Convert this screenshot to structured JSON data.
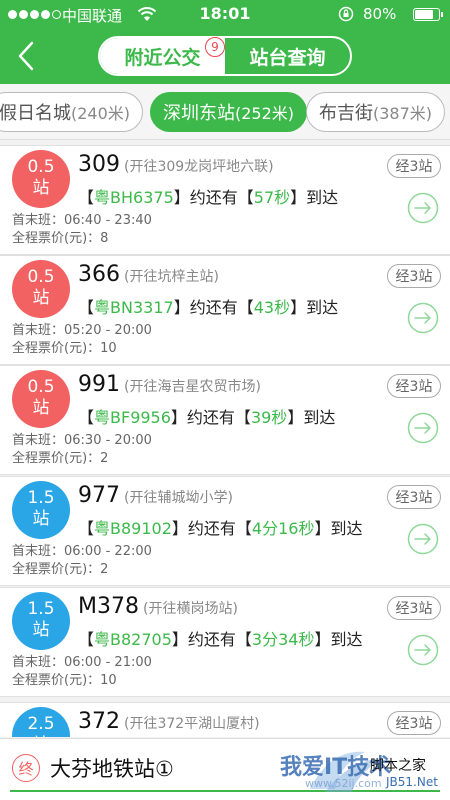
{
  "status_bar": {
    "carrier": "中国联通",
    "time": "18:01",
    "battery": "80%",
    "battery_level": 0.8
  },
  "header": {
    "tabs": [
      {
        "label": "附近公交",
        "badge": "9"
      },
      {
        "label": "站台查询"
      }
    ]
  },
  "stations": [
    {
      "name": "假日名城",
      "dist": "(240米)"
    },
    {
      "name": "深圳东站",
      "dist": "(252米)"
    },
    {
      "name": "布吉街",
      "dist": "(387米)"
    }
  ],
  "routes": [
    {
      "fare": "0.5",
      "fare_unit": "站",
      "color": "#f26262",
      "number": "309",
      "direction": "(开往309龙岗坪地六联)",
      "plate_open": "【",
      "plate": "粤BH6375",
      "mid": "】约还有【",
      "eta": "57秒",
      "tail": "】到达",
      "schedule": "首末班：06:40 - 23:40",
      "price": "全程票价(元)：8",
      "stops": "经3站"
    },
    {
      "fare": "0.5",
      "fare_unit": "站",
      "color": "#f26262",
      "number": "366",
      "direction": "(开往坑梓主站)",
      "plate_open": "【",
      "plate": "粤BN3317",
      "mid": "】约还有【",
      "eta": "43秒",
      "tail": "】到达",
      "schedule": "首末班：05:20 - 20:00",
      "price": "全程票价(元)：10",
      "stops": "经3站"
    },
    {
      "fare": "0.5",
      "fare_unit": "站",
      "color": "#f26262",
      "number": "991",
      "direction": "(开往海吉星农贸市场)",
      "plate_open": "【",
      "plate": "粤BF9956",
      "mid": "】约还有【",
      "eta": "39秒",
      "tail": "】到达",
      "schedule": "首末班：06:30 - 20:00",
      "price": "全程票价(元)：2",
      "stops": "经3站"
    },
    {
      "fare": "1.5",
      "fare_unit": "站",
      "color": "#2aa5e6",
      "number": "977",
      "direction": "(开往辅城坳小学)",
      "plate_open": "【",
      "plate": "粤B89102",
      "mid": "】约还有【",
      "eta": "4分16秒",
      "tail": "】到达",
      "schedule": "首末班：06:00 - 22:00",
      "price": "全程票价(元)：2",
      "stops": "经3站"
    },
    {
      "fare": "1.5",
      "fare_unit": "站",
      "color": "#2aa5e6",
      "number": "M378",
      "direction": "(开往横岗场站)",
      "plate_open": "【",
      "plate": "粤B82705",
      "mid": "】约还有【",
      "eta": "3分34秒",
      "tail": "】到达",
      "schedule": "首末班：06:00 - 21:00",
      "price": "全程票价(元)：10",
      "stops": "经3站"
    },
    {
      "fare": "2.5",
      "fare_unit": "站",
      "color": "#2aa5e6",
      "number": "372",
      "direction": "(开往372平湖山厦村)",
      "stops": "经3站"
    }
  ],
  "bottom": {
    "end_label": "终",
    "destination": "大芬地铁站①"
  },
  "watermark": {
    "text": "我爱IT技术",
    "site": "www.52ij.com",
    "jb_top": "脚本之家",
    "jb_bottom": "JB51.Net"
  },
  "colors": {
    "accent": "#3cb94a",
    "near_fare": "#f26262",
    "far_fare": "#2aa5e6"
  }
}
